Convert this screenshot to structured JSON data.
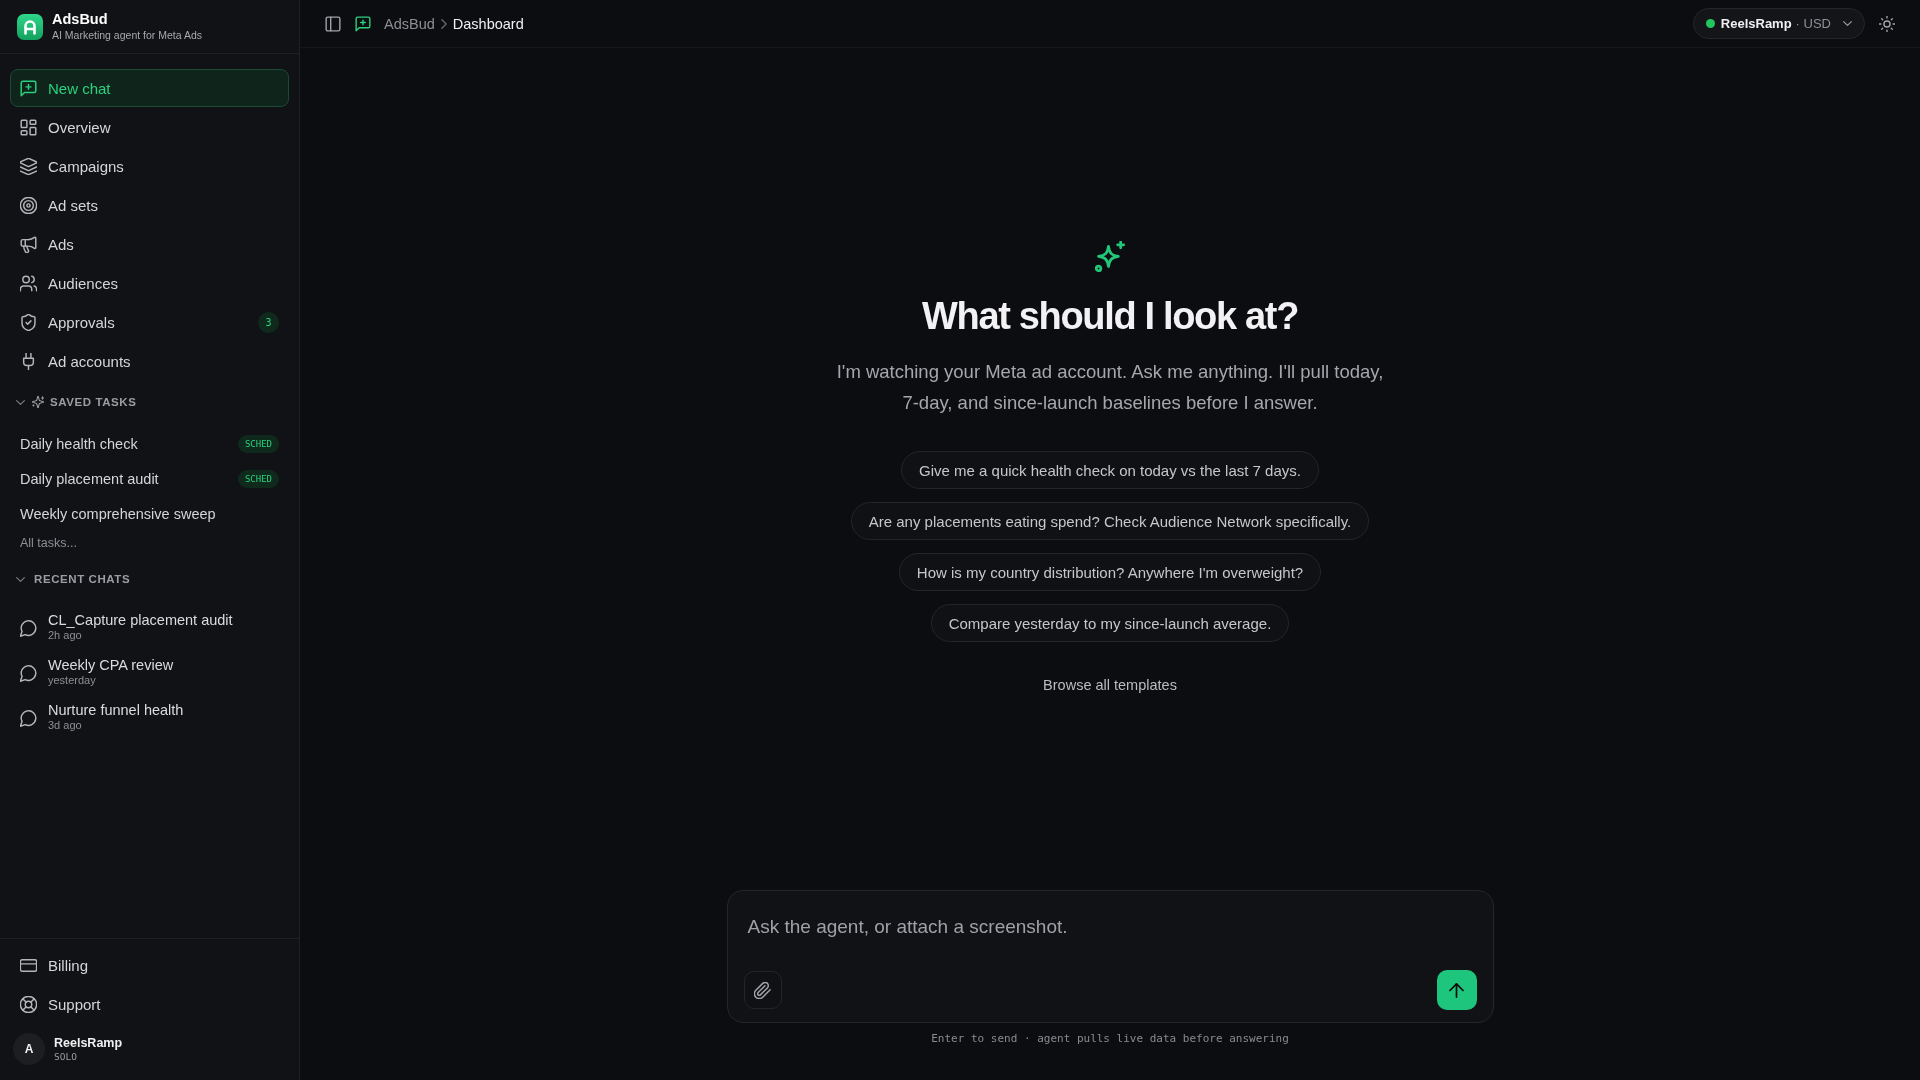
{
  "sidebar": {
    "brand": {
      "name": "AdsBud",
      "tagline": "AI Marketing agent for Meta Ads"
    },
    "nav": [
      {
        "label": "New chat",
        "selected": true
      },
      {
        "label": "Overview",
        "selected": false
      },
      {
        "label": "Campaigns",
        "selected": false
      },
      {
        "label": "Ad sets",
        "selected": false
      },
      {
        "label": "Ads",
        "selected": false
      },
      {
        "label": "Audiences",
        "selected": false
      },
      {
        "label": "Approvals",
        "selected": false,
        "badge": "3"
      },
      {
        "label": "Ad accounts",
        "selected": false
      }
    ],
    "saved_tasks": {
      "title": "SAVED TASKS",
      "expanded": true,
      "items": [
        {
          "label": "Daily health check",
          "selected": false,
          "badge": "SCHED"
        },
        {
          "label": "Daily placement audit",
          "selected": false,
          "badge": "SCHED"
        },
        {
          "label": "Weekly comprehensive sweep",
          "selected": false
        }
      ],
      "more": "All tasks..."
    },
    "recent_chats": {
      "title": "RECENT CHATS",
      "expanded": true,
      "items": [
        {
          "title": "CL_Capture placement audit",
          "time": "2h ago",
          "selected": false
        },
        {
          "title": "Weekly CPA review",
          "time": "yesterday",
          "selected": false
        },
        {
          "title": "Nurture funnel health",
          "time": "3d ago",
          "selected": false
        }
      ]
    },
    "footer_links": [
      {
        "label": "Billing"
      },
      {
        "label": "Support"
      }
    ],
    "user": {
      "initial": "A",
      "name": "ReelsRamp",
      "plan": "SOLO"
    }
  },
  "topbar": {
    "breadcrumb": [
      {
        "label": "AdsBud"
      },
      {
        "label": "Dashboard"
      }
    ],
    "account": {
      "name": "ReelsRamp",
      "currency": "· USD",
      "connected": true
    }
  },
  "hero": {
    "title": "What should I look at?",
    "subtitle": "I'm watching your Meta ad account. Ask me anything. I'll pull today, 7-day, and since-launch baselines before I answer.",
    "suggestions": [
      "Give me a quick health check on today vs the last 7 days.",
      "Are any placements eating spend? Check Audience Network specifically.",
      "How is my country distribution? Anywhere I'm overweight?",
      "Compare yesterday to my since-launch average."
    ],
    "browse_link": "Browse all templates"
  },
  "composer": {
    "placeholder": "Ask the agent, or attach a screenshot.",
    "hint": "Enter to send · agent pulls live data before answering"
  }
}
